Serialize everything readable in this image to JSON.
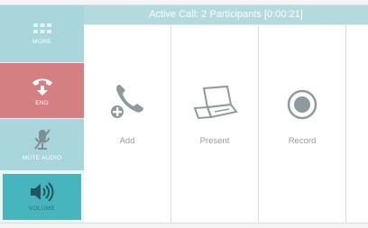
{
  "call": {
    "title": "Active Call: 2 Participants [0:00:21]"
  },
  "sidebar": {
    "more_label": "MORE",
    "end_label": "END",
    "mute_label": "MUTE AUDIO",
    "volume_label": "VOLUME"
  },
  "actions": [
    {
      "label": "Add",
      "icon": "add-participant-icon"
    },
    {
      "label": "Present",
      "icon": "laptop-icon"
    },
    {
      "label": "Record",
      "icon": "record-icon"
    }
  ],
  "colors": {
    "sidebar_light": "#a9d6da",
    "end_red": "#d47f82",
    "volume_active": "#47b5bd",
    "title_bar": "#b3dadd"
  }
}
